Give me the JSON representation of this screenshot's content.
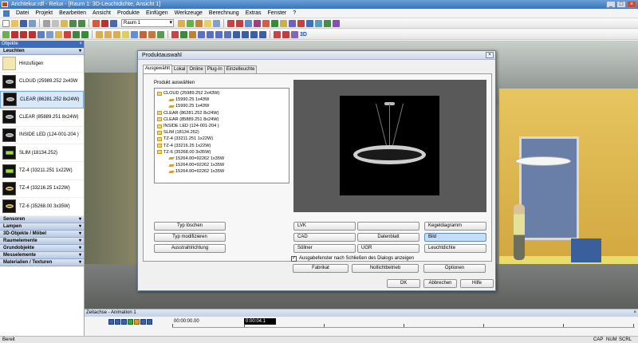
{
  "window": {
    "title": "Arichtekur.rdf - Relux - [Raum 1: 3D-Leuchtdichte, Ansicht 1]",
    "controls": [
      "_",
      "□",
      "×"
    ]
  },
  "menu": [
    "Datei",
    "Projekt",
    "Bearbeiten",
    "Ansicht",
    "Produkte",
    "Einfügen",
    "Werkzeuge",
    "Berechnung",
    "Extras",
    "Fenster",
    "?"
  ],
  "toolbar": {
    "room_select": "Raum 1",
    "badge_3d": "3D"
  },
  "left_panel": {
    "header": "Objekte",
    "close": "×",
    "active_section": "Leuchten",
    "items": [
      {
        "label": "Hinzufügen",
        "icon": "add-lamp-icon"
      },
      {
        "label": "CLOUD (25989.252 2x43W",
        "icon": "cloud-lamp-icon"
      },
      {
        "label": "CLEAR (86281.252 8x24W)",
        "icon": "clear-lamp-icon",
        "selected": true
      },
      {
        "label": "CLEAR (85889.251 8x24W)",
        "icon": "clear-lamp-icon"
      },
      {
        "label": "INSIDE LED (124-001-204 )",
        "icon": "inside-led-icon"
      },
      {
        "label": "SLIM (18134.252)",
        "icon": "slim-lamp-icon"
      },
      {
        "label": "TZ-4 (33211.251 1x22W)",
        "icon": "tz4-lamp-icon"
      },
      {
        "label": "TZ-4 (33216.25 1x22W)",
        "icon": "tz4-lamp-icon"
      },
      {
        "label": "TZ-6 (35268.00 3x35W)",
        "icon": "tz6-lamp-icon"
      }
    ],
    "sections": [
      "Sensoren",
      "Lampen",
      "3D-Objekte / Möbel",
      "Raumelemente",
      "Grundobjekte",
      "Messelemente",
      "Materialien / Texturen"
    ]
  },
  "dialog": {
    "title": "Produktauswahl",
    "tabs": [
      "Ausgewählt",
      "Lokal",
      "Online",
      "Plug-In",
      "Einzelleuchte"
    ],
    "active_tab": "Ausgewählt",
    "tree_label": "Produkt auswählen",
    "tree": [
      {
        "label": "CLOUD (25989.252 2x43W)",
        "level": 0
      },
      {
        "label": "15990.25 1x43W",
        "level": 1
      },
      {
        "label": "15990.25 1x43W",
        "level": 1
      },
      {
        "label": "CLEAR (86281.252 8x24W)",
        "level": 0
      },
      {
        "label": "CLEAR (85889.251 8x24W)",
        "level": 0
      },
      {
        "label": "INSIDE LED (124-001-204 )",
        "level": 0
      },
      {
        "label": "SLIM (18134.252)",
        "level": 0
      },
      {
        "label": "TZ-4 (33211.251 1x22W)",
        "level": 0
      },
      {
        "label": "TZ-4 (33216.25 1x22W)",
        "level": 0
      },
      {
        "label": "TZ-6 (35268.00 3x35W)",
        "level": 0
      },
      {
        "label": "15264.00=92262 1x35W",
        "level": 1
      },
      {
        "label": "15264.00=92262 1x35W",
        "level": 1
      },
      {
        "label": "15264.00=92262 1x35W",
        "level": 1
      }
    ],
    "buttons": {
      "typ_loeschen": "Typ löschen",
      "typ_modifizieren": "Typ modifizieren",
      "ausstrahlrichtung": "Ausstrahlrichtung",
      "lvk": "LVK",
      "cad": "CAD",
      "datenblatt": "Datenblatt",
      "soellner": "Söllner",
      "ugr": "UGR",
      "kegeldiagramm": "Kegeldiagramm",
      "bild": "Bild",
      "leuchtdichte": "Leuchtdichte",
      "fabrikat": "Fabrikat",
      "notlichtbetrieb": "Notlichtbetrieb",
      "optionen": "Optionen",
      "ok": "OK",
      "abbrechen": "Abbrechen",
      "hilfe": "Hilfe"
    },
    "checkbox": {
      "label": "Ausgabefenster nach Schließen des Dialogs anzeigen",
      "checked": true,
      "mark": "✓"
    }
  },
  "timeline": {
    "title": "Zeitachse - Animation 1",
    "close": "×",
    "start_time": "00:00:00.00",
    "current_time": "0:00:04.1"
  },
  "status": {
    "text": "Bereit",
    "indicators": [
      "CAP",
      "NUM",
      "SCRL"
    ]
  }
}
